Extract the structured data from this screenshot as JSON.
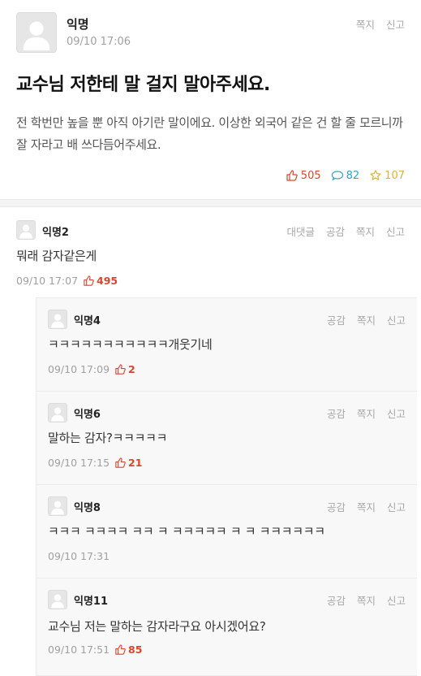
{
  "post": {
    "author": "익명",
    "time": "09/10 17:06",
    "actions": [
      "쪽지",
      "신고"
    ],
    "title": "교수님 저한테 말 걸지 말아주세요.",
    "body": "전 학번만 높을 뿐 아직 아기란 말이에요. 이상한 외국어 같은 건 할 줄 모르니까 잘 자라고 배 쓰다듬어주세요.",
    "likes": "505",
    "comments": "82",
    "scraps": "107"
  },
  "colors": {
    "like": "#d9452f",
    "comment": "#2ea3c5",
    "scrap": "#e0b233"
  },
  "comment": {
    "author": "익명2",
    "actions": [
      "대댓글",
      "공감",
      "쪽지",
      "신고"
    ],
    "text": "뭐래 감자같은게",
    "time": "09/10 17:07",
    "likes": "495"
  },
  "replies": [
    {
      "author": "익명4",
      "actions": [
        "공감",
        "쪽지",
        "신고"
      ],
      "text": "ㅋㅋㅋㅋㅋㅋㅋㅋㅋㅋㅋ개웃기네",
      "time": "09/10 17:09",
      "likes": "2"
    },
    {
      "author": "익명6",
      "actions": [
        "공감",
        "쪽지",
        "신고"
      ],
      "text": "말하는 감자?ㅋㅋㅋㅋㅋ",
      "time": "09/10 17:15",
      "likes": "21"
    },
    {
      "author": "익명8",
      "actions": [
        "공감",
        "쪽지",
        "신고"
      ],
      "text": "ㅋㅋㅋ ㅋㅋㅋㅋ ㅋㅋ ㅋ ㅋㅋㅋㅋㅋ ㅋ ㅋ ㅋㅋㅋㅋㅋㅋ",
      "time": "09/10 17:31",
      "likes": null
    },
    {
      "author": "익명11",
      "actions": [
        "공감",
        "쪽지",
        "신고"
      ],
      "text": "교수님 저는 말하는 감자라구요 아시겠어요?",
      "time": "09/10 17:51",
      "likes": "85"
    }
  ]
}
